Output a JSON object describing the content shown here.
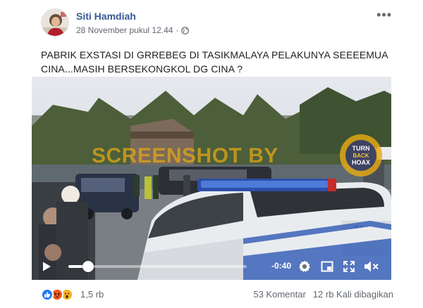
{
  "post": {
    "author": "Siti Hamdiah",
    "timestamp": "28 November pukul 12.44",
    "privacy_icon": "globe-icon",
    "text": "PABRIK EXSTASI DI GRREBEG DI TASIKMALAYA PELAKUNYA SEEEEMUA CINA...MASIH BERSEKONGKOL DG CINA ?"
  },
  "video": {
    "watermark_text": "SCREENSHOT BY",
    "logo": {
      "line1": "TURN",
      "line2": "BACK",
      "line3": "HOAX"
    },
    "time_remaining": "-0:40",
    "progress": 0.11,
    "icons": [
      "play-icon",
      "settings-icon",
      "picture-in-picture-icon",
      "fullscreen-icon",
      "volume-muted-icon"
    ]
  },
  "footer": {
    "reactions": [
      "like",
      "angry",
      "wow"
    ],
    "reaction_count": "1,5 rb",
    "comments": "53 Komentar",
    "shares": "12 rb Kali dibagikan"
  },
  "colors": {
    "author": "#385898",
    "meta": "#616770",
    "like": "#2078f4",
    "angry": "#e9710f",
    "wow": "#f7b125"
  }
}
